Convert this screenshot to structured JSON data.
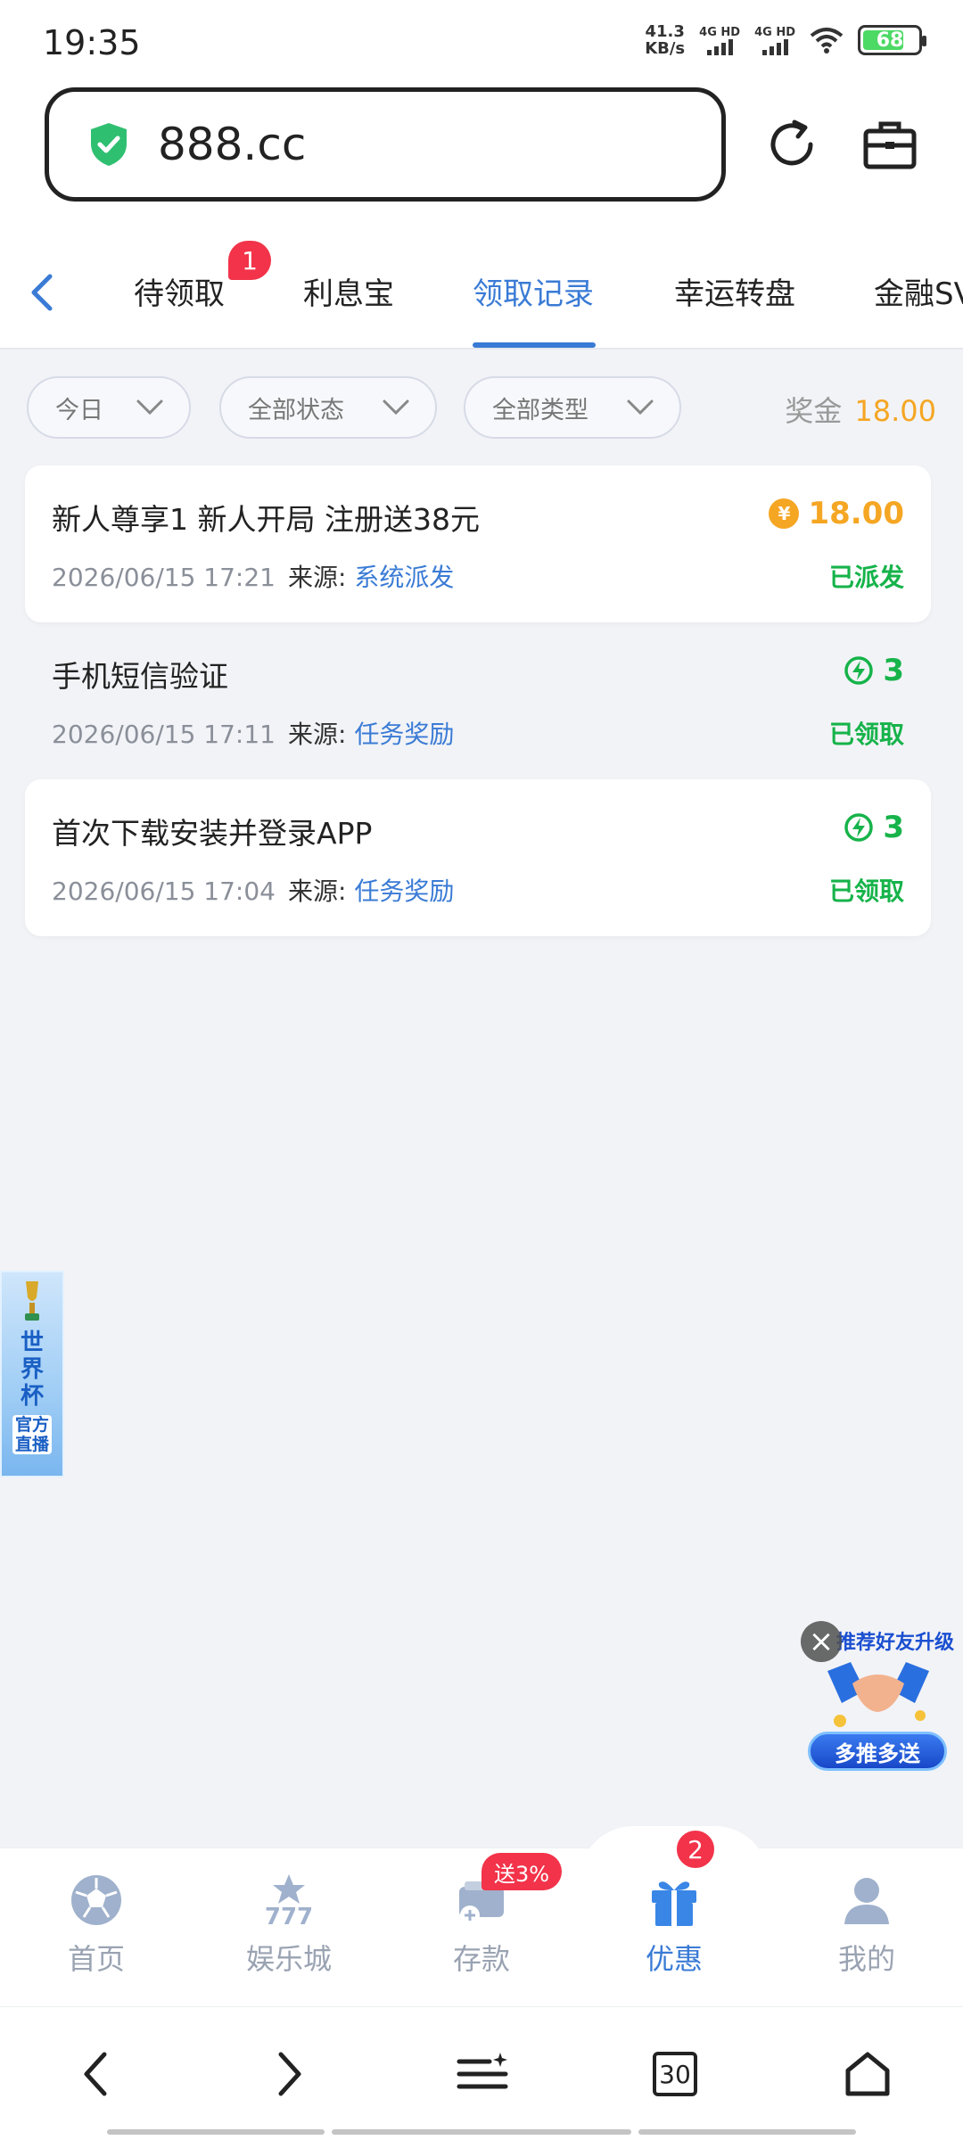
{
  "status_bar": {
    "time": "19:35",
    "speed": "41.3",
    "speed_unit": "KB/s",
    "net1": "4G HD",
    "net2": "4G HD",
    "battery": "68"
  },
  "browser": {
    "url": "888.cc",
    "tab_count": "30"
  },
  "tabs": [
    {
      "label": "待领取",
      "badge": "1"
    },
    {
      "label": "利息宝"
    },
    {
      "label": "领取记录",
      "active": true
    },
    {
      "label": "幸运转盘"
    },
    {
      "label": "金融SV"
    }
  ],
  "filters": {
    "date": "今日",
    "status": "全部状态",
    "type": "全部类型"
  },
  "bonus": {
    "label": "奖金",
    "value": "18.00"
  },
  "records": [
    {
      "title": "新人尊享1 新人开局 注册送38元",
      "date": "2026/06/15 17:21",
      "source_label": "来源:",
      "source": "系统派发",
      "amount": "18.00",
      "amount_icon": "yen-coin-icon",
      "status": "已派发"
    },
    {
      "title": "手机短信验证",
      "date": "2026/06/15 17:11",
      "source_label": "来源:",
      "source": "任务奖励",
      "amount": "3",
      "amount_icon": "lightning-icon",
      "status": "已领取"
    },
    {
      "title": "首次下载安装并登录APP",
      "date": "2026/06/15 17:04",
      "source_label": "来源:",
      "source": "任务奖励",
      "amount": "3",
      "amount_icon": "lightning-icon",
      "status": "已领取"
    }
  ],
  "worldcup_float": {
    "title": "世界杯",
    "sub": "官方直播"
  },
  "promo_float": {
    "top": "推荐好友升级",
    "bottom": "多推多送"
  },
  "bottom_nav": [
    {
      "label": "首页",
      "icon": "soccer-ball-icon"
    },
    {
      "label": "娱乐城",
      "icon": "slot-777-icon"
    },
    {
      "label": "存款",
      "icon": "deposit-icon",
      "tag": "送3%"
    },
    {
      "label": "优惠",
      "icon": "gift-icon",
      "badge": "2",
      "active": true
    },
    {
      "label": "我的",
      "icon": "user-icon"
    }
  ],
  "colors": {
    "accent": "#3a7bd5",
    "gold": "#f5a623",
    "green": "#16b34a",
    "red": "#f2334a"
  }
}
